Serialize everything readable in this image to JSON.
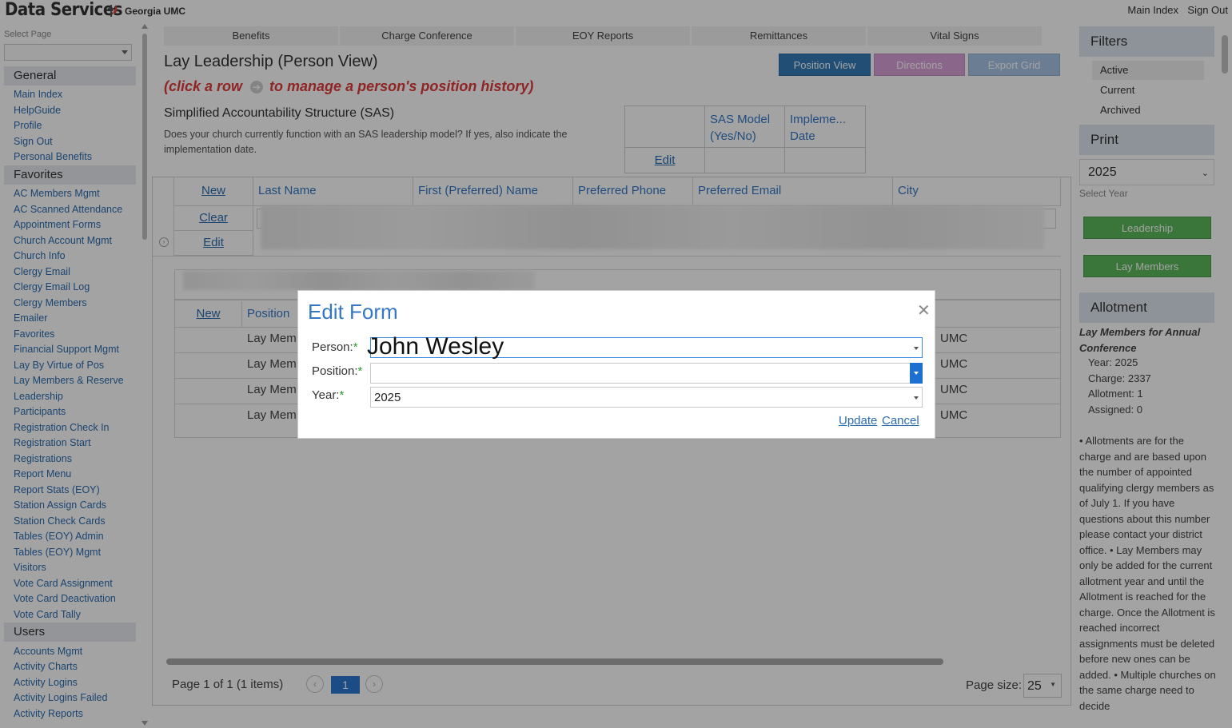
{
  "brand": {
    "title": "Data Services",
    "org": "Georgia UMC"
  },
  "top_links": {
    "main_index": "Main Index",
    "sign_out": "Sign Out"
  },
  "sidebar": {
    "select_label": "Select Page",
    "sections": [
      {
        "title": "General",
        "items": [
          "Main Index",
          "HelpGuide",
          "Profile",
          "Sign Out",
          "Personal Benefits"
        ]
      },
      {
        "title": "Favorites",
        "items": [
          "AC Members Mgmt",
          "AC Scanned Attendance",
          "Appointment Forms",
          "Church Account Mgmt",
          "Church Info",
          "Clergy Email",
          "Clergy Email Log",
          "Clergy Members",
          "Emailer",
          "Favorites",
          "Financial Support Mgmt",
          "Lay By Virtue of Pos",
          "Lay Members & Reserve",
          "Leadership",
          "Participants",
          "Registration Check In",
          "Registration Start",
          "Registrations",
          "Report Menu",
          "Report Stats (EOY)",
          "Station Assign Cards",
          "Station Check Cards",
          "Tables (EOY) Admin",
          "Tables (EOY) Mgmt",
          "Visitors",
          "Vote Card Assignment",
          "Vote Card Deactivation",
          "Vote Card Tally"
        ]
      },
      {
        "title": "Users",
        "items": [
          "Accounts Mgmt",
          "Activity Charts",
          "Activity Logins",
          "Activity Logins Failed",
          "Activity Reports"
        ]
      }
    ]
  },
  "tabs": [
    "Benefits",
    "Charge Conference",
    "EOY Reports",
    "Remittances",
    "Vital Signs"
  ],
  "page": {
    "title": "Lay Leadership (Person View)",
    "instruction_pre": "(click a row",
    "instruction_post": "to manage a person's position history)",
    "buttons": {
      "position_view": "Position View",
      "directions": "Directions",
      "export_grid": "Export Grid"
    }
  },
  "sas": {
    "title": "Simplified Accountability Structure (SAS)",
    "description": "Does your church currently function with an SAS leadership model? If yes, also indicate the implementation date.",
    "col_model": "SAS Model (Yes/No)",
    "col_date": "Impleme... Date",
    "edit": "Edit"
  },
  "grid": {
    "new": "New",
    "clear": "Clear",
    "edit": "Edit",
    "columns": [
      "Last Name",
      "First (Preferred) Name",
      "Preferred Phone",
      "Preferred Email",
      "City"
    ],
    "sub": {
      "new": "New",
      "position_col": "Position",
      "rows": [
        {
          "position": "Lay Mem",
          "church": "UMC"
        },
        {
          "position": "Lay Mem",
          "church": "UMC"
        },
        {
          "position": "Lay Mem",
          "church": "UMC"
        },
        {
          "position": "Lay Mem",
          "church": "UMC"
        }
      ]
    },
    "pager": {
      "text": "Page 1 of 1 (1 items)",
      "current": "1",
      "size_label": "Page size:",
      "size": "25"
    }
  },
  "right": {
    "filters_title": "Filters",
    "filters": [
      "Active",
      "Current",
      "Archived"
    ],
    "print_title": "Print",
    "year": "2025",
    "select_year": "Select Year",
    "leadership_btn": "Leadership",
    "lay_members_btn": "Lay Members",
    "allotment_title": "Allotment",
    "allot_heading": "Lay Members for Annual Conference",
    "allot_year": "Year: 2025",
    "allot_charge": "Charge: 2337",
    "allot_allotment": "Allotment: 1",
    "allot_assigned": "Assigned: 0",
    "notes": "• Allotments are for the charge and are based upon the number of appointed qualifying clergy members as of July 1. If you have questions about this number please contact your district office. • Lay Members may only be added for the current allotment year and until the Allotment is reached for the charge. Once the Allotment is reached incorrect assignments must be deleted before new ones can be added. • Multiple churches on the same charge need to decide"
  },
  "modal": {
    "title": "Edit Form",
    "person_label": "Person:",
    "position_label": "Position:",
    "year_label": "Year:",
    "required": "*",
    "person_value": "John Wesley",
    "position_value": "",
    "year_value": "2025",
    "update": "Update",
    "cancel": "Cancel"
  },
  "colors": {
    "accent": "#3478c5",
    "required": "#2e9b2e",
    "instruction": "#e03a3a",
    "green": "#5cb85c"
  }
}
